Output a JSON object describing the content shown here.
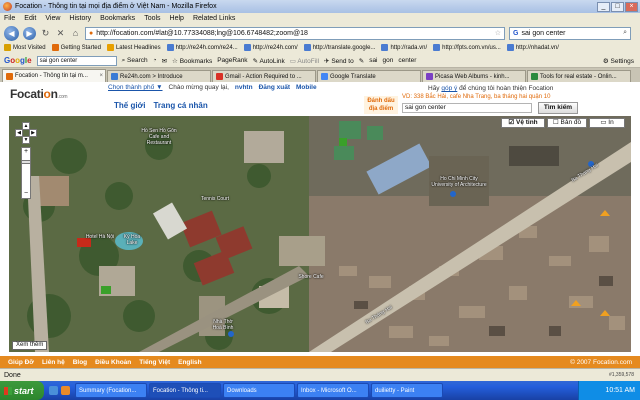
{
  "window": {
    "title": "Focation - Thông tin tại mọi địa điểm ở Việt Nam - Mozilla Firefox"
  },
  "menu": [
    "File",
    "Edit",
    "View",
    "History",
    "Bookmarks",
    "Tools",
    "Help",
    "Related Links"
  ],
  "nav": {
    "url": "http://focation.com/#lat@10.77334088;lng@106.6748482;zoom@18",
    "search_value": "sai gon center"
  },
  "bookmarks": [
    "Most Visited",
    "Getting Started",
    "Latest Headlines",
    "http://re24h.com/re24...",
    "http://re24h.com/",
    "http://translate.google...",
    "http://rada.vn/",
    "http://fpts.com.vn/us...",
    "http://nhadat.vn/"
  ],
  "google_toolbar": {
    "logo": [
      "G",
      "o",
      "o",
      "g",
      "l",
      "e"
    ],
    "search_value": "sai gon center",
    "items": [
      "Search",
      "Bookmarks",
      "PageRank",
      "AutoLink",
      "AutoFill",
      "Send to",
      "sai",
      "gon",
      "center"
    ],
    "settings": "Settings"
  },
  "tabs": [
    {
      "label": "Focation - Thông tin tại m...",
      "color": "#e06a0a",
      "active": true
    },
    {
      "label": "Re24h.com > Introduce",
      "color": "#3a7bd5",
      "active": false
    },
    {
      "label": "Gmail - Action Required to ...",
      "color": "#d93025",
      "active": false
    },
    {
      "label": "Google Translate",
      "color": "#4285f4",
      "active": false
    },
    {
      "label": "Picasa Web Albums - kinh...",
      "color": "#7b3fc4",
      "active": false
    },
    {
      "label": "Tools for real estate - Onlin...",
      "color": "#2b8a3e",
      "active": false
    }
  ],
  "site": {
    "logo_main": "Focati",
    "logo_o": "o",
    "logo_n": "n",
    "logo_domain": ".com",
    "city_link": "Chọn thành phố ▼",
    "greeting": "Chào mừng quay lại,",
    "username": "nvhtn",
    "logout": "Đăng xuất",
    "mobile": "Mobile",
    "nav_world": "Thế giới",
    "nav_profile": "Trang cá nhân",
    "place_tag": "Đánh dấu địa điểm",
    "hint_prefix": "Hãy",
    "hint_link": "góp ý",
    "hint_suffix": "để chúng tôi hoàn thiện Focation",
    "hint_example": "VD: 338 Bắc Hải, cafe Nha Trang, ba tháng hai quận 10",
    "search_value": "sai gon center",
    "search_button": "Tìm kiếm"
  },
  "map": {
    "types": [
      "Vệ tinh",
      "Bản đồ",
      "In"
    ],
    "more": "Xem thêm",
    "labels": [
      "Hồ Sen Hồ Gôn Cafe and Restaurant",
      "Tennis Court",
      "Kỳ Hòa Lake",
      "Hotel Hà Nội",
      "Ho Chi Minh City University of Architecture",
      "Ba Thang Hai",
      "Ba Tháng Hai",
      "Shore Cafe",
      "Nhà Thờ Hoà Bình"
    ]
  },
  "footer": {
    "links": [
      "Giúp Đỡ",
      "Liên hệ",
      "Blog",
      "Điều Khoản",
      "Tiếng Việt",
      "English"
    ],
    "copyright": "© 2007 Focation.com"
  },
  "status": {
    "text": "Done",
    "resolution": "#1,359,578"
  },
  "taskbar": {
    "start": "start",
    "tasks": [
      "Summary (Focation...",
      "Focation - Thông ti...",
      "Downloads",
      "Inbox - Microsoft O...",
      "duilietty - Paint"
    ],
    "time": "10:51 AM"
  }
}
